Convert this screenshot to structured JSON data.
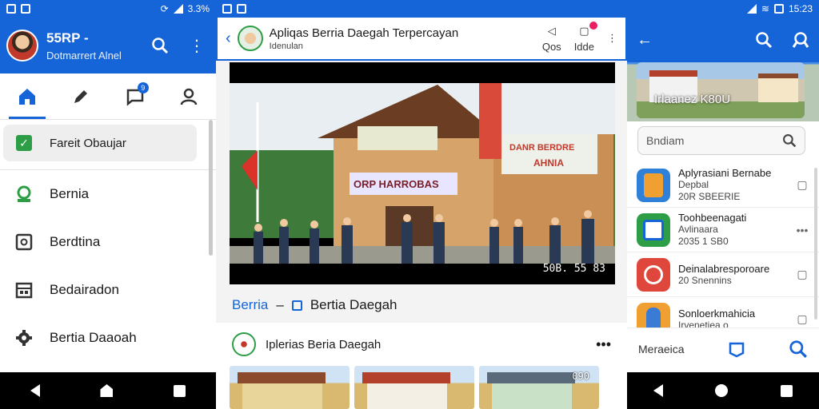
{
  "left": {
    "status": {
      "icons": [
        "notification-icon",
        "mail-icon"
      ],
      "right_text": "3.3%"
    },
    "header": {
      "title": "55RP -",
      "subtitle": "Dotmarrert Alnel"
    },
    "pill": {
      "label": "Fareit Obaujar"
    },
    "menu": [
      {
        "label": "Bernia",
        "icon": "location-icon"
      },
      {
        "label": "Berdtina",
        "icon": "square-icon"
      },
      {
        "label": "Bedairadon",
        "icon": "calendar-icon"
      },
      {
        "label": "Bertia Daaoah",
        "icon": "gear-icon"
      }
    ],
    "tab_badge": "9"
  },
  "mid": {
    "appbar": {
      "title": "Apliqas Berria Daegah Terpercayan",
      "subtitle": "Idenulan",
      "action1": "Qos",
      "action2": "Idde"
    },
    "photo": {
      "time": "50B. 55 83",
      "banner_left": "ORP HARROBAS",
      "banner_right_1": "DANR BERDRE",
      "banner_right_2": "AHNIA"
    },
    "caption": {
      "left": "Berria",
      "dash": "–",
      "right": "Bertia Daegah"
    },
    "card": {
      "title": "Iplerias Beria Daegah",
      "thumb_label": "090"
    }
  },
  "right": {
    "status": {
      "time": "15:23"
    },
    "hero_text": "Irlaanez K80U",
    "search": {
      "placeholder": "Bndiam"
    },
    "list": [
      {
        "title": "Aplyrasiani Bernabe",
        "sub": "Depbal",
        "line3": "20R SBEERIE",
        "trail": "bookmark",
        "color": "#2f80d8"
      },
      {
        "title": "Toohbeenagati",
        "sub": "Avlinaara",
        "line3": "2035 1 SB0",
        "trail": "•••",
        "color": "#2e9e46"
      },
      {
        "title": "Deinalabresporoare",
        "sub": "20 Snennins",
        "line3": "",
        "trail": "bookmark",
        "color": "#e0473c"
      },
      {
        "title": "Sonloerkmahicia",
        "sub": "Irvenetiea o",
        "line3": "",
        "trail": "bookmark",
        "color": "#f0a030"
      }
    ],
    "bottom": {
      "label": "Meraeica"
    }
  }
}
